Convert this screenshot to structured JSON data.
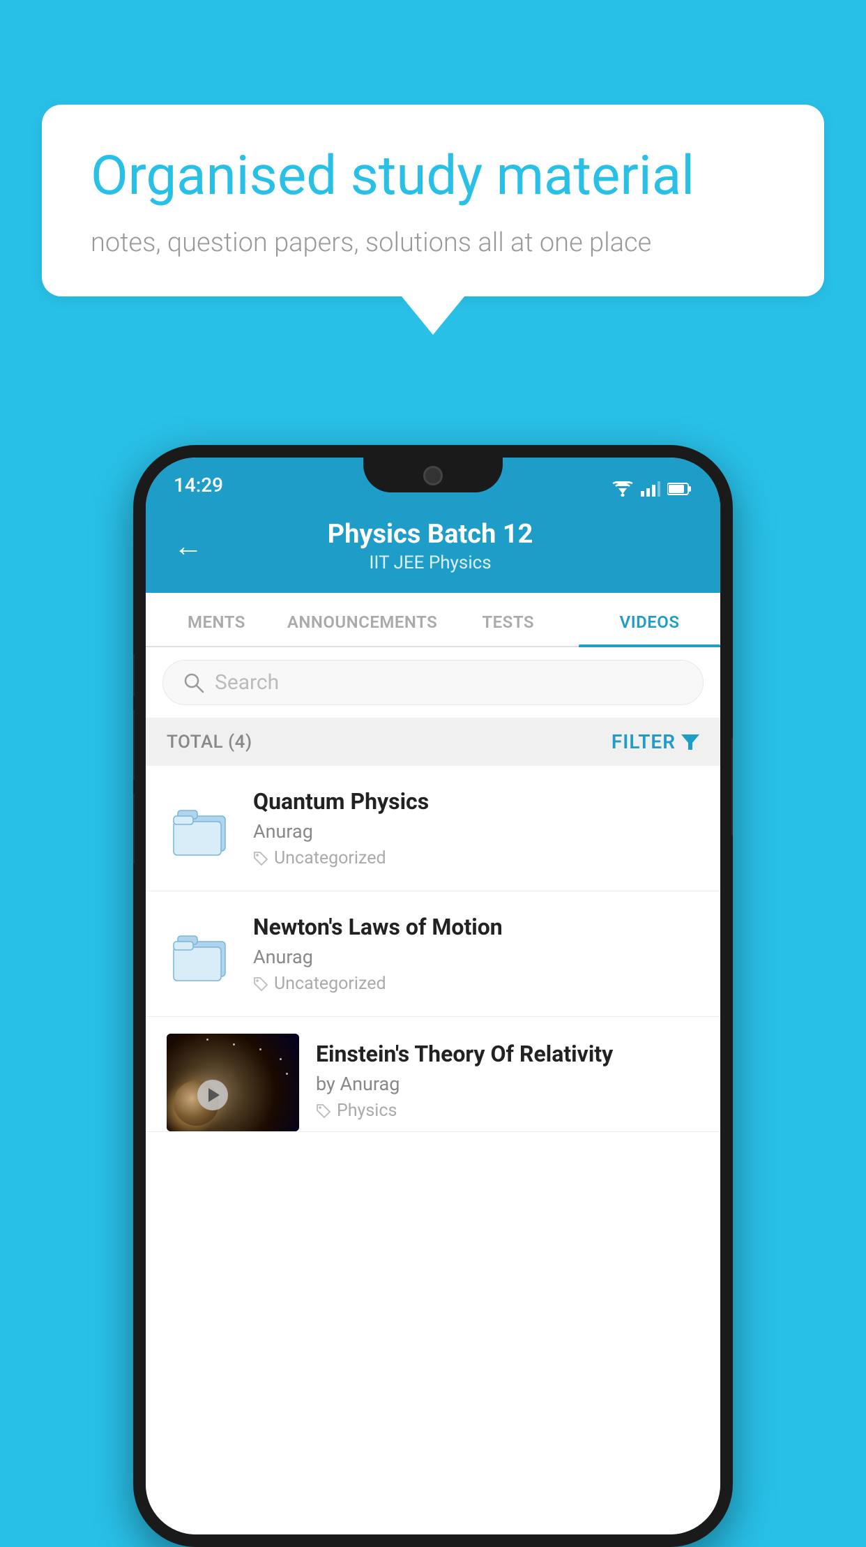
{
  "background_color": "#29C0E8",
  "speech_bubble": {
    "title": "Organised study material",
    "subtitle": "notes, question papers, solutions all at one place"
  },
  "phone": {
    "status_bar": {
      "time": "14:29"
    },
    "header": {
      "title": "Physics Batch 12",
      "subtitle": "IIT JEE   Physics",
      "back_label": "←"
    },
    "tabs": [
      {
        "label": "MENTS",
        "active": false
      },
      {
        "label": "ANNOUNCEMENTS",
        "active": false
      },
      {
        "label": "TESTS",
        "active": false
      },
      {
        "label": "VIDEOS",
        "active": true
      }
    ],
    "search": {
      "placeholder": "Search"
    },
    "filter_row": {
      "total": "TOTAL (4)",
      "filter_label": "FILTER"
    },
    "videos": [
      {
        "title": "Quantum Physics",
        "author": "Anurag",
        "tag": "Uncategorized",
        "type": "folder"
      },
      {
        "title": "Newton's Laws of Motion",
        "author": "Anurag",
        "tag": "Uncategorized",
        "type": "folder"
      },
      {
        "title": "Einstein's Theory Of Relativity",
        "author": "by Anurag",
        "tag": "Physics",
        "type": "video"
      }
    ]
  }
}
